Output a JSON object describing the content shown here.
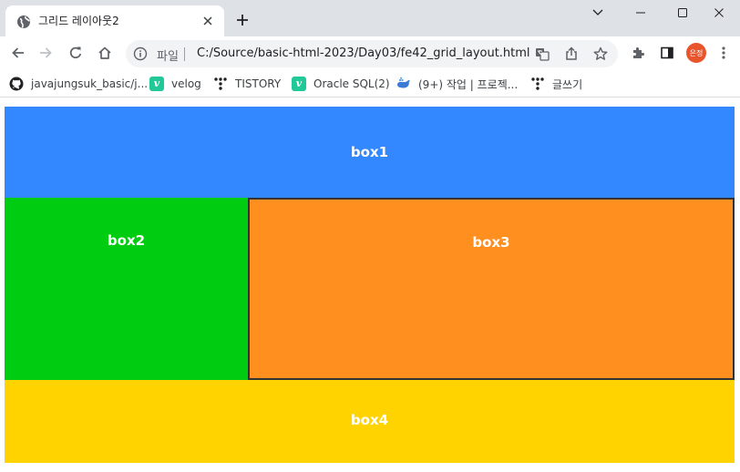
{
  "tab": {
    "title": "그리드 레이아웃2",
    "favicon": "globe-icon"
  },
  "toolbar": {
    "scheme_label": "파일",
    "url": "C:/Source/basic-html-2023/Day03/fe42_grid_layout.html",
    "profile_label": "은정"
  },
  "bookmarks": [
    {
      "label": "javajungsuk_basic/j...",
      "icon": "github-icon"
    },
    {
      "label": "velog",
      "icon": "velog-icon"
    },
    {
      "label": "TISTORY",
      "icon": "tistory-icon"
    },
    {
      "label": "Oracle SQL(2)",
      "icon": "velog-icon"
    },
    {
      "label": "(9+) 작업 | 프로젝...",
      "icon": "whale-icon"
    },
    {
      "label": "글쓰기",
      "icon": "tistory-icon"
    }
  ],
  "page": {
    "boxes": [
      {
        "label": "box1",
        "color": "#3388ff"
      },
      {
        "label": "box2",
        "color": "#00cc11"
      },
      {
        "label": "box3",
        "color": "#ff8f1f"
      },
      {
        "label": "box4",
        "color": "#ffd300"
      }
    ]
  },
  "colors": {
    "tabstrip_bg": "#dee1e6",
    "omnibox_bg": "#f1f3f4",
    "avatar_bg": "#e8542b",
    "box3_border": "#333333"
  }
}
